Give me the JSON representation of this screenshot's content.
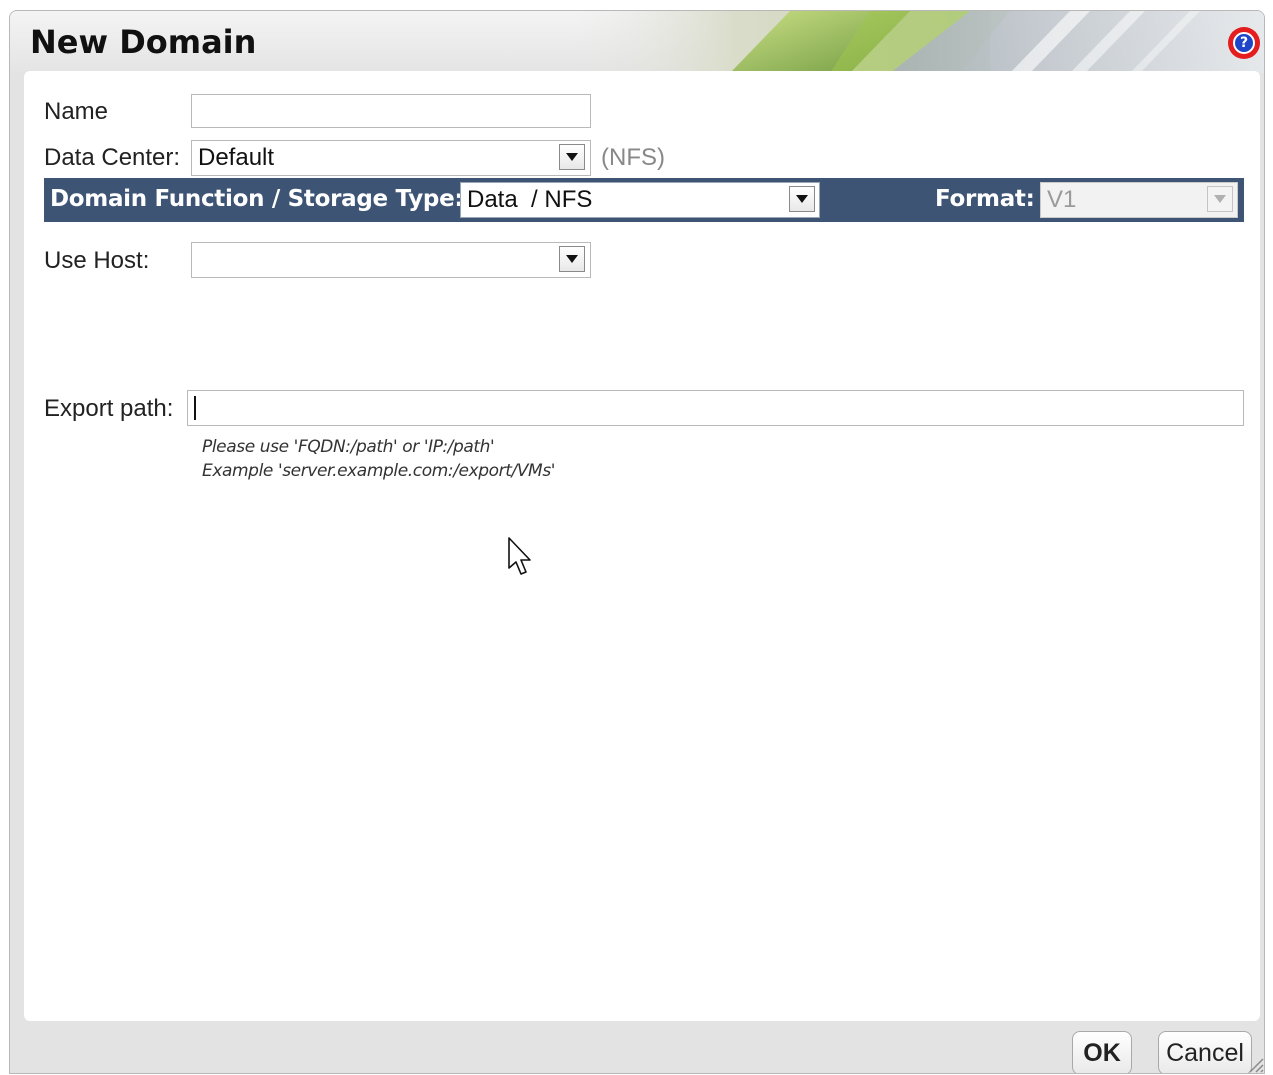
{
  "dialog": {
    "title": "New Domain",
    "help_icon": "question-icon"
  },
  "form": {
    "name": {
      "label": "Name",
      "value": ""
    },
    "data_center": {
      "label": "Data Center:",
      "value": "Default",
      "note": "(NFS)"
    },
    "domain_function": {
      "label": "Domain Function / Storage Type:",
      "value": "Data  / NFS"
    },
    "format": {
      "label": "Format:",
      "value": "V1"
    },
    "use_host": {
      "label": "Use Host:",
      "value": ""
    },
    "export_path": {
      "label": "Export path:",
      "value": "",
      "hint_line1": "Please use 'FQDN:/path' or 'IP:/path'",
      "hint_line2": "Example 'server.example.com:/export/VMs'"
    }
  },
  "buttons": {
    "ok": "OK",
    "cancel": "Cancel"
  },
  "colors": {
    "band": "#3e5475",
    "help_outer": "#e41e1e",
    "help_inner": "#1e46c8"
  }
}
